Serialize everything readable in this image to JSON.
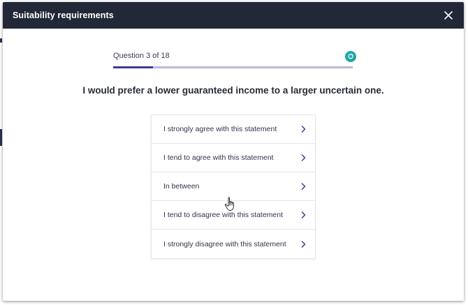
{
  "modal": {
    "title": "Suitability requirements",
    "close_icon": "close-icon"
  },
  "progress": {
    "label": "Question 3 of 18",
    "current": 3,
    "total": 18,
    "icon": "refresh-icon",
    "fill_color": "#3b3a9e",
    "track_color": "#b9b7e0"
  },
  "question": {
    "text": "I would prefer a lower guaranteed income to a larger uncertain one."
  },
  "options": [
    {
      "label": "I strongly agree with this statement"
    },
    {
      "label": "I tend to agree with this statement"
    },
    {
      "label": "In between"
    },
    {
      "label": "I tend to disagree with this statement"
    },
    {
      "label": "I strongly disagree with this statement"
    }
  ],
  "colors": {
    "header_bg": "#222838",
    "accent": "#3b3a9e",
    "teal": "#1fa7a7"
  }
}
